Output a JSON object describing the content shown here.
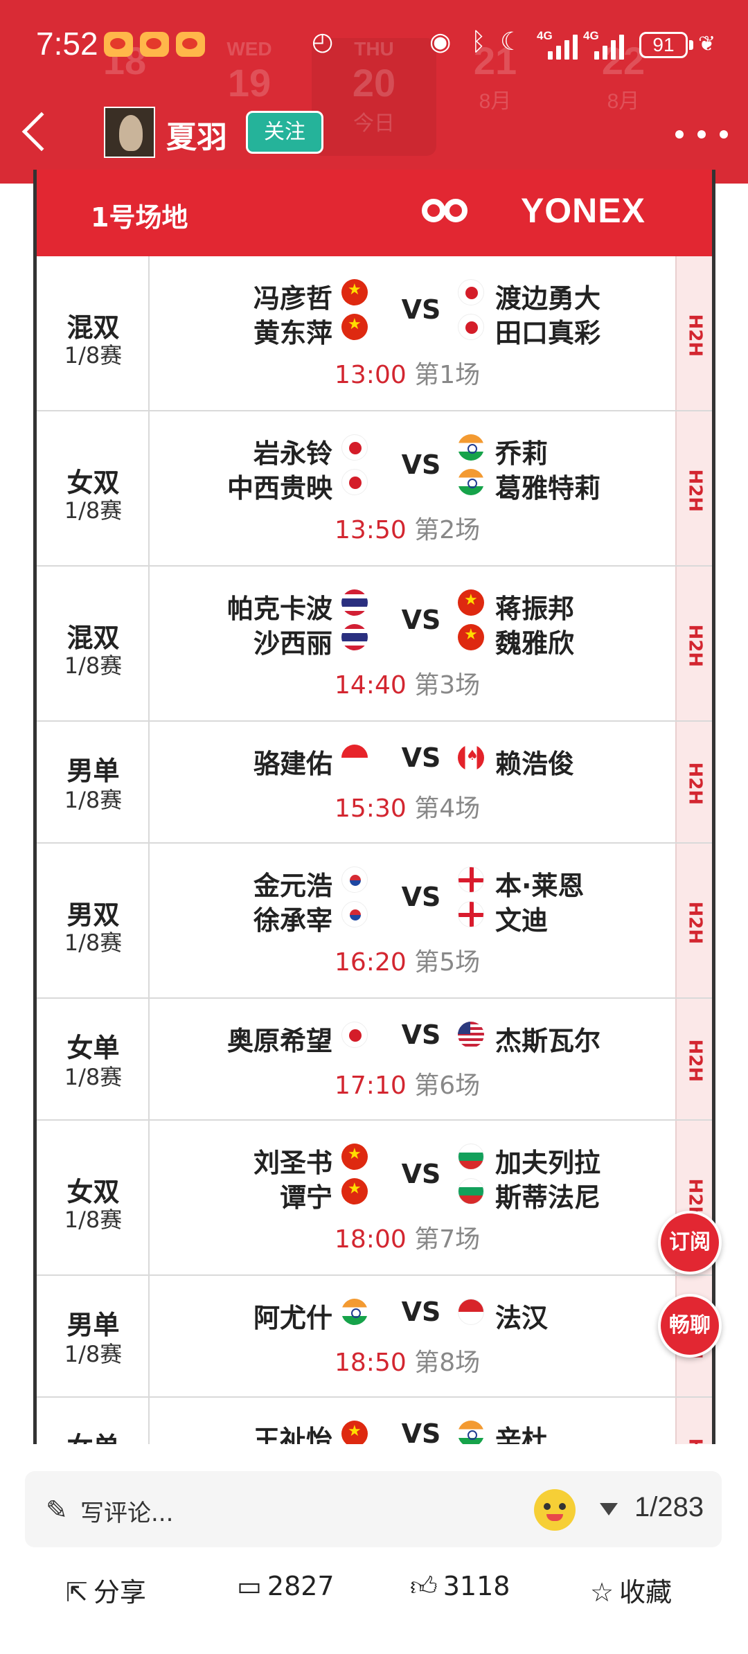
{
  "status": {
    "time": "7:52",
    "battery": "91",
    "net1": "4G",
    "net2": "4G"
  },
  "dates": [
    {
      "w": "",
      "d": "18",
      "m": ""
    },
    {
      "w": "WED",
      "d": "19",
      "m": ""
    },
    {
      "w": "THU",
      "d": "20",
      "m": "今日"
    },
    {
      "w": "",
      "d": "21",
      "m": "8月"
    },
    {
      "w": "",
      "d": "22",
      "m": "8月"
    }
  ],
  "header": {
    "username": "夏羽",
    "follow_label": "关注"
  },
  "court": {
    "name": "1号场地",
    "brand": "YONEX"
  },
  "vs_label": "VS",
  "h2h_label": "H2H",
  "matches": [
    {
      "cat": "混双",
      "round": "1/8赛",
      "left": [
        "冯彦哲",
        "黄东萍"
      ],
      "right": [
        "渡边勇大",
        "田口真彩"
      ],
      "time": "13:00",
      "num": "第1场"
    },
    {
      "cat": "女双",
      "round": "1/8赛",
      "left": [
        "岩永铃",
        "中西贵映"
      ],
      "right": [
        "乔莉",
        "葛雅特莉"
      ],
      "time": "13:50",
      "num": "第2场"
    },
    {
      "cat": "混双",
      "round": "1/8赛",
      "left": [
        "帕克卡波",
        "沙西丽"
      ],
      "right": [
        "蒋振邦",
        "魏雅欣"
      ],
      "time": "14:40",
      "num": "第3场"
    },
    {
      "cat": "男单",
      "round": "1/8赛",
      "left": [
        "骆建佑"
      ],
      "right": [
        "赖浩俊"
      ],
      "time": "15:30",
      "num": "第4场"
    },
    {
      "cat": "男双",
      "round": "1/8赛",
      "left": [
        "金元浩",
        "徐承宰"
      ],
      "right": [
        "本·莱恩",
        "文迪"
      ],
      "time": "16:20",
      "num": "第5场"
    },
    {
      "cat": "女单",
      "round": "1/8赛",
      "left": [
        "奥原希望"
      ],
      "right": [
        "杰斯瓦尔"
      ],
      "time": "17:10",
      "num": "第6场"
    },
    {
      "cat": "女双",
      "round": "1/8赛",
      "left": [
        "刘圣书",
        "谭宁"
      ],
      "right": [
        "加夫列拉",
        "斯蒂法尼"
      ],
      "time": "18:00",
      "num": "第7场"
    },
    {
      "cat": "男单",
      "round": "1/8赛",
      "left": [
        "阿尤什"
      ],
      "right": [
        "法汉"
      ],
      "time": "18:50",
      "num": "第8场"
    },
    {
      "cat": "女单",
      "round": "",
      "left": [
        "王祉怡"
      ],
      "right": [
        "辛杜"
      ],
      "time": "",
      "num": ""
    }
  ],
  "fab": {
    "subscribe": "订阅",
    "chat": "畅聊"
  },
  "comment": {
    "placeholder": "写评论...",
    "page": "1/283"
  },
  "actions": {
    "share": "分享",
    "comments": "2827",
    "likes": "3118",
    "favorite": "收藏"
  }
}
